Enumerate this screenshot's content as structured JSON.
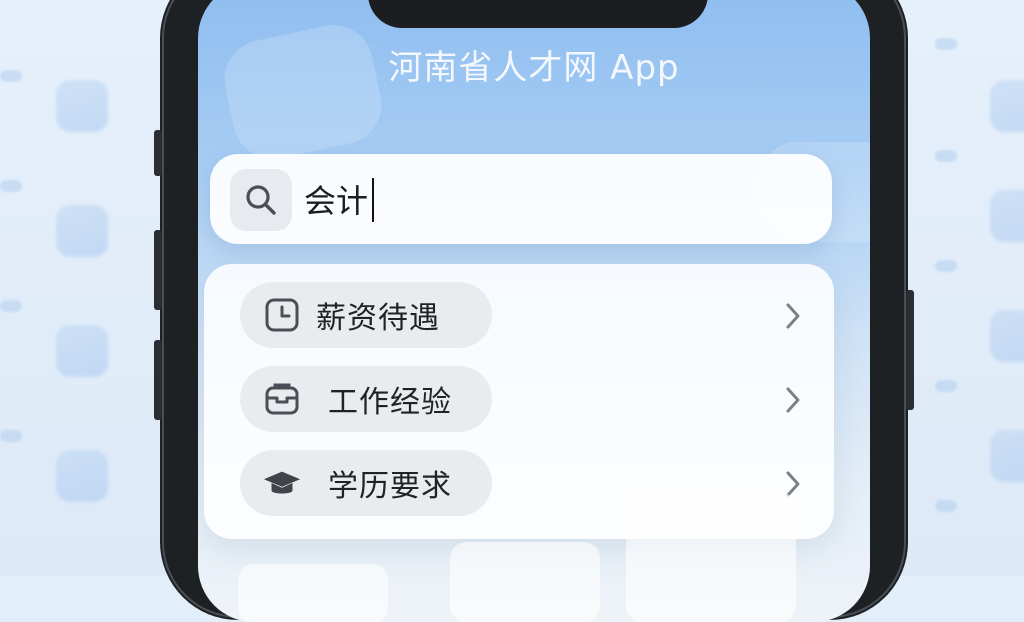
{
  "app": {
    "title": "河南省人才网 App"
  },
  "search": {
    "query": "会计",
    "icon": "search-icon"
  },
  "suggestions": [
    {
      "label": "薪资待遇",
      "icon": "clock-icon"
    },
    {
      "label": "工作经验",
      "icon": "briefcase-icon"
    },
    {
      "label": "学历要求",
      "icon": "graduation-cap-icon"
    }
  ],
  "colors": {
    "sky_top": "#8ebdf0",
    "pill_bg": "#e9ebee",
    "text": "#1f2226",
    "icon": "#4a4f57"
  }
}
